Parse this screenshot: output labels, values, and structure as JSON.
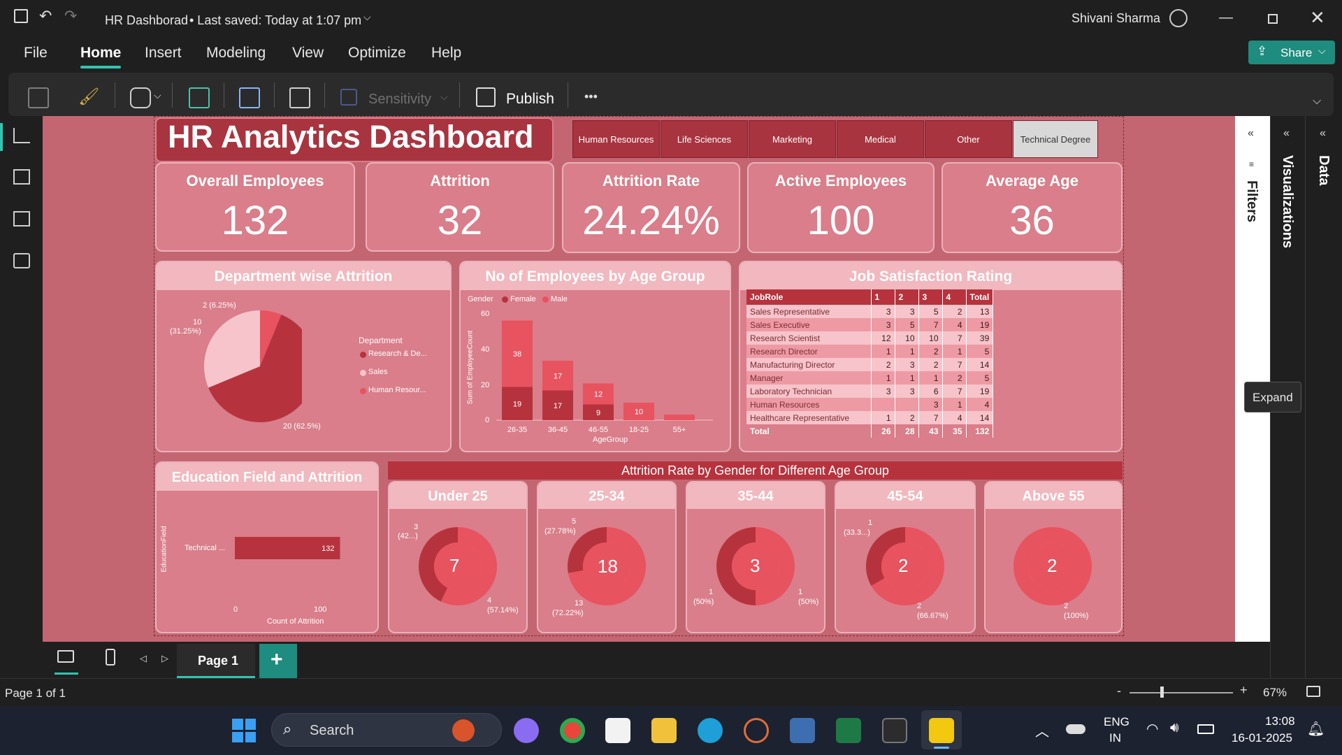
{
  "window": {
    "title": "HR Dashborad",
    "saved": "• Last saved: Today at 1:07 pm",
    "user": "Shivani Sharma"
  },
  "menu": [
    "File",
    "Home",
    "Insert",
    "Modeling",
    "View",
    "Optimize",
    "Help"
  ],
  "menu_active": "Home",
  "share_label": "Share",
  "ribbon": {
    "sensitivity": "Sensitivity",
    "publish": "Publish",
    "more": "•••"
  },
  "dashboard": {
    "title": "HR Analytics Dashboard",
    "slicers": [
      "Human Resources",
      "Life Sciences",
      "Marketing",
      "Medical",
      "Other",
      "Technical Degree"
    ],
    "selected_slicer": "Technical Degree",
    "kpis": [
      {
        "title": "Overall Employees",
        "value": "132"
      },
      {
        "title": "Attrition",
        "value": "32"
      },
      {
        "title": "Attrition Rate",
        "value": "24.24%"
      },
      {
        "title": "Active Employees",
        "value": "100"
      },
      {
        "title": "Average Age",
        "value": "36"
      }
    ],
    "dept": {
      "title": "Department wise Attrition",
      "legend_title": "Department",
      "legend": [
        "Research & De...",
        "Sales",
        "Human Resour..."
      ],
      "labels": [
        "2 (6.25%)",
        "10",
        "(31.25%)",
        "20 (62.5%)"
      ]
    },
    "agegroup": {
      "title": "No of Employees by Age Group",
      "legend_title": "Gender",
      "legend": [
        "Female",
        "Male"
      ],
      "ylabel": "Sum of EmployeeCount",
      "xlabel": "AgeGroup",
      "yticks": [
        "60",
        "40",
        "20",
        "0"
      ]
    },
    "jobsat": {
      "title": "Job Satisfaction Rating",
      "headers": [
        "JobRole",
        "1",
        "2",
        "3",
        "4",
        "Total"
      ],
      "rows": [
        [
          "Sales Representative",
          "3",
          "3",
          "5",
          "2",
          "13"
        ],
        [
          "Sales Executive",
          "3",
          "5",
          "7",
          "4",
          "19"
        ],
        [
          "Research Scientist",
          "12",
          "10",
          "10",
          "7",
          "39"
        ],
        [
          "Research Director",
          "1",
          "1",
          "2",
          "1",
          "5"
        ],
        [
          "Manufacturing Director",
          "2",
          "3",
          "2",
          "7",
          "14"
        ],
        [
          "Manager",
          "1",
          "1",
          "1",
          "2",
          "5"
        ],
        [
          "Laboratory Technician",
          "3",
          "3",
          "6",
          "7",
          "19"
        ],
        [
          "Human Resources",
          "",
          "",
          "3",
          "1",
          "4"
        ],
        [
          "Healthcare Representative",
          "1",
          "2",
          "7",
          "4",
          "14"
        ]
      ],
      "total": [
        "Total",
        "26",
        "28",
        "43",
        "35",
        "132"
      ]
    },
    "edu": {
      "title": "Education Field and Attrition",
      "ylabel": "EducationField",
      "xlabel": "Count of Attrition",
      "category": "Technical ...",
      "value_label": "132",
      "xticks": [
        "0",
        "100"
      ]
    },
    "gender_title": "Attrition Rate by Gender for Different Age Group",
    "donuts": [
      {
        "title": "Under 25",
        "center": "7",
        "l1": "3",
        "l2": "(42...)",
        "l3": "4",
        "l4": "(57.14%)"
      },
      {
        "title": "25-34",
        "center": "18",
        "l1": "5",
        "l2": "(27.78%)",
        "l3": "13",
        "l4": "(72.22%)"
      },
      {
        "title": "35-44",
        "center": "3",
        "l1": "1",
        "l2": "(50%)",
        "l3": "1",
        "l4": "(50%)"
      },
      {
        "title": "45-54",
        "center": "2",
        "l1": "1",
        "l2": "(33.3...)",
        "l3": "2",
        "l4": "(66.67%)"
      },
      {
        "title": "Above 55",
        "center": "2",
        "l1": "",
        "l2": "",
        "l3": "2",
        "l4": "(100%)"
      }
    ]
  },
  "chart_data": [
    {
      "type": "pie",
      "title": "Department wise Attrition",
      "categories": [
        "Research & Development",
        "Sales",
        "Human Resources"
      ],
      "values": [
        20,
        10,
        2
      ],
      "colors": [
        "#b6333e",
        "#f6c4ca",
        "#e85360"
      ],
      "legend_position": "right"
    },
    {
      "type": "bar",
      "title": "No of Employees by Age Group",
      "categories": [
        "26-35",
        "36-45",
        "46-55",
        "18-25",
        "55+"
      ],
      "series": [
        {
          "name": "Female",
          "values": [
            19,
            17,
            9,
            0,
            0
          ]
        },
        {
          "name": "Male",
          "values": [
            38,
            17,
            12,
            10,
            0
          ]
        }
      ],
      "data_labels": [
        [
          "19",
          "17",
          "9",
          "",
          ""
        ],
        [
          "38",
          "17",
          "12",
          "10",
          ""
        ]
      ],
      "stacked": true,
      "ylim": [
        0,
        60
      ],
      "xlabel": "AgeGroup",
      "ylabel": "Sum of EmployeeCount",
      "colors": [
        "#b6333e",
        "#e85360"
      ]
    },
    {
      "type": "bar",
      "orientation": "horizontal",
      "title": "Education Field and Attrition",
      "categories": [
        "Technical ..."
      ],
      "values": [
        132
      ],
      "xlim": [
        0,
        160
      ],
      "xlabel": "Count of Attrition",
      "ylabel": "EducationField",
      "colors": [
        "#b6333e"
      ]
    },
    {
      "type": "pie",
      "subtype": "donut",
      "title": "Attrition Rate by Gender for Different Age Group",
      "groups": [
        "Under 25",
        "25-34",
        "35-44",
        "45-54",
        "Above 55"
      ],
      "series": [
        {
          "values": [
            3,
            5,
            1,
            1,
            0
          ]
        },
        {
          "values": [
            4,
            13,
            1,
            2,
            2
          ]
        }
      ],
      "colors": [
        "#b6333e",
        "#e85360"
      ]
    }
  ],
  "pane": {
    "filters": "Filters",
    "visualizations": "Visualizations",
    "data": "Data",
    "expand": "Expand"
  },
  "pagebar": {
    "page_tab": "Page 1",
    "add": "+"
  },
  "status": {
    "page": "Page 1 of 1",
    "zoom": "67%"
  },
  "taskbar": {
    "search": "Search",
    "lang1": "ENG",
    "lang2": "IN",
    "time": "13:08",
    "date": "16-01-2025"
  }
}
